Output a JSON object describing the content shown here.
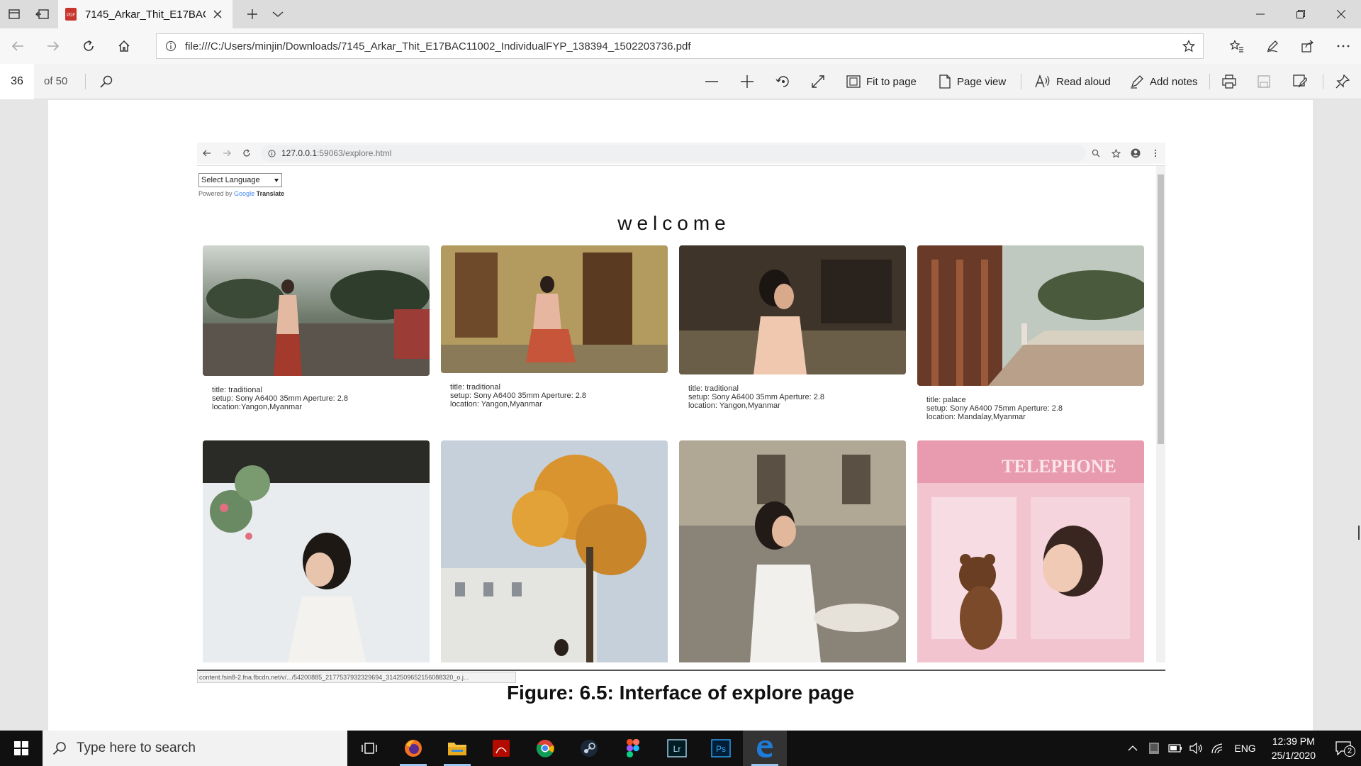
{
  "browser": {
    "tab_title": "7145_Arkar_Thit_E17BAC",
    "url": "file:///C:/Users/minjin/Downloads/7145_Arkar_Thit_E17BAC11002_IndividualFYP_138394_1502203736.pdf"
  },
  "pdf_toolbar": {
    "page_number": "36",
    "page_total": "of 50",
    "fit_to_page": "Fit to page",
    "page_view": "Page view",
    "read_aloud": "Read aloud",
    "add_notes": "Add notes"
  },
  "screenshot": {
    "url_host": "127.0.0.1",
    "url_path": ":59063/explore.html",
    "language_select": "Select Language",
    "powered_by": "Powered by",
    "google": "Google",
    "translate": "Translate",
    "welcome": "welcome",
    "status_url": "content.fsin8-2.fna.fbcdn.net/v/.../54200885_2177537932329694_3142509652156088320_o.j...",
    "cards": [
      {
        "title": "title: traditional",
        "setup": "setup: Sony A6400 35mm Aperture: 2.8",
        "location": "location:Yangon,Myanmar"
      },
      {
        "title": "title: traditional",
        "setup": "setup: Sony A6400 35mm Aperture: 2.8",
        "location": "location: Yangon,Myanmar"
      },
      {
        "title": "title: traditional",
        "setup": "setup: Sony A6400 35mm Aperture: 2.8",
        "location": "location: Yangon,Myanmar"
      },
      {
        "title": "title: palace",
        "setup": "setup: Sony A6400 75mm Aperture: 2.8",
        "location": "location: Mandalay,Myanmar"
      }
    ]
  },
  "figure_caption": "Figure: 6.5: Interface of explore page",
  "taskbar": {
    "search_placeholder": "Type here to search",
    "lang": "ENG",
    "time": "12:39 PM",
    "date": "25/1/2020",
    "notifications": "2"
  },
  "colors": {
    "pdf_red": "#c8352c",
    "edge_blue": "#1e7cd8",
    "taskbar": "#101010"
  }
}
